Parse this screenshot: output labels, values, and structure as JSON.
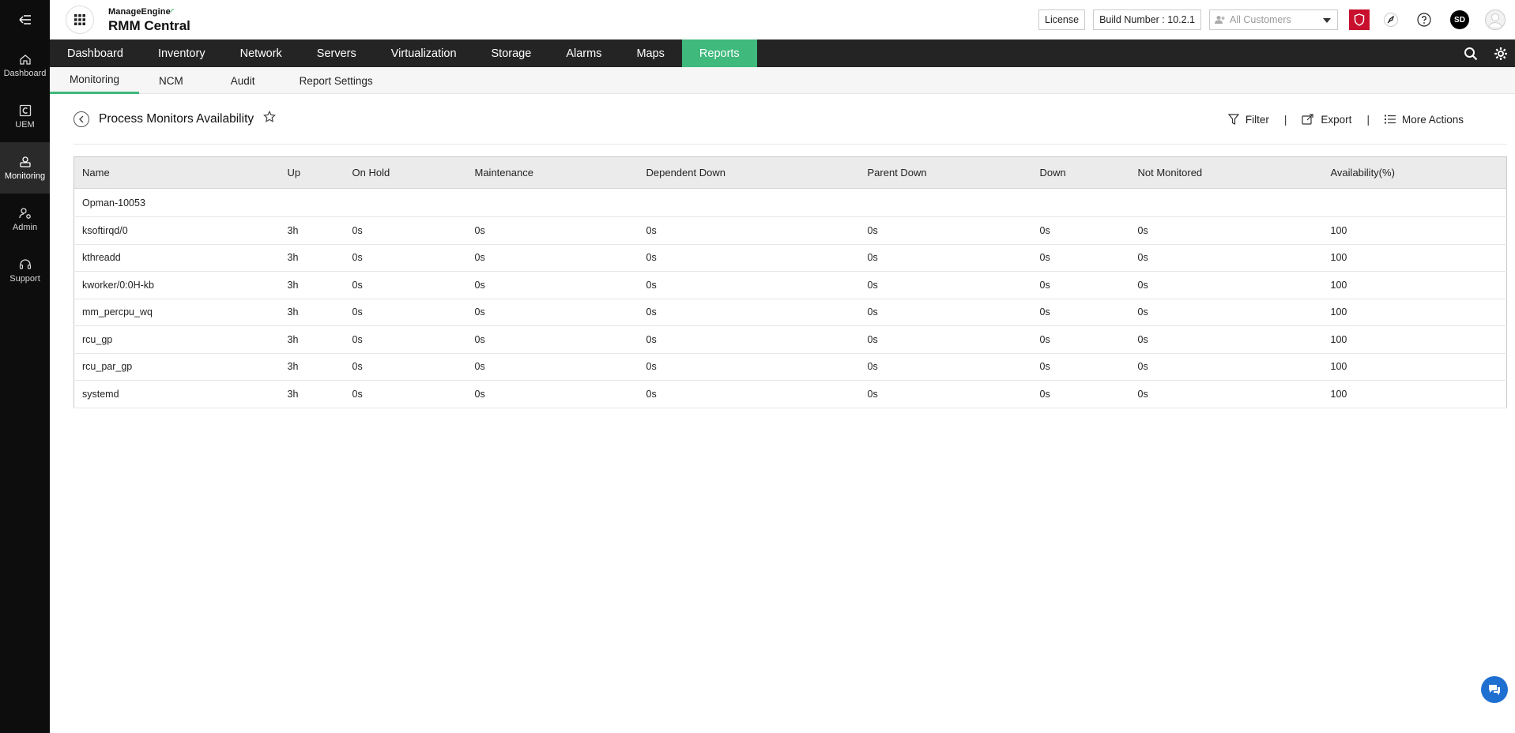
{
  "rail": {
    "items": [
      {
        "label": "Dashboard"
      },
      {
        "label": "UEM"
      },
      {
        "label": "Monitoring"
      },
      {
        "label": "Admin"
      },
      {
        "label": "Support"
      }
    ]
  },
  "header": {
    "brand_top": "ManageEngine",
    "brand_main": "RMM Central",
    "license_label": "License",
    "build_number": "Build Number : 10.2.1",
    "customer_placeholder": "All Customers",
    "avatar_initials": "SD"
  },
  "mainnav": {
    "items": [
      {
        "label": "Dashboard"
      },
      {
        "label": "Inventory"
      },
      {
        "label": "Network"
      },
      {
        "label": "Servers"
      },
      {
        "label": "Virtualization"
      },
      {
        "label": "Storage"
      },
      {
        "label": "Alarms"
      },
      {
        "label": "Maps"
      },
      {
        "label": "Reports"
      }
    ]
  },
  "subnav": {
    "items": [
      {
        "label": "Monitoring"
      },
      {
        "label": "NCM"
      },
      {
        "label": "Audit"
      },
      {
        "label": "Report Settings"
      }
    ]
  },
  "page": {
    "title": "Process Monitors Availability",
    "filter_label": "Filter",
    "export_label": "Export",
    "more_label": "More Actions",
    "separator": "|"
  },
  "table": {
    "headers": [
      "Name",
      "Up",
      "On Hold",
      "Maintenance",
      "Dependent Down",
      "Parent Down",
      "Down",
      "Not Monitored",
      "Availability(%)"
    ],
    "group": "Opman-10053",
    "rows": [
      [
        "ksoftirqd/0",
        "3h",
        "0s",
        "0s",
        "0s",
        "0s",
        "0s",
        "0s",
        "100"
      ],
      [
        "kthreadd",
        "3h",
        "0s",
        "0s",
        "0s",
        "0s",
        "0s",
        "0s",
        "100"
      ],
      [
        "kworker/0:0H-kb",
        "3h",
        "0s",
        "0s",
        "0s",
        "0s",
        "0s",
        "0s",
        "100"
      ],
      [
        "mm_percpu_wq",
        "3h",
        "0s",
        "0s",
        "0s",
        "0s",
        "0s",
        "0s",
        "100"
      ],
      [
        "rcu_gp",
        "3h",
        "0s",
        "0s",
        "0s",
        "0s",
        "0s",
        "0s",
        "100"
      ],
      [
        "rcu_par_gp",
        "3h",
        "0s",
        "0s",
        "0s",
        "0s",
        "0s",
        "0s",
        "100"
      ],
      [
        "systemd",
        "3h",
        "0s",
        "0s",
        "0s",
        "0s",
        "0s",
        "0s",
        "100"
      ]
    ]
  },
  "colors": {
    "accent": "#3fb97c",
    "nav_bg": "#242424",
    "rail_bg": "#0d0d0d",
    "alert": "#c8102e",
    "chat": "#1f6fd1"
  }
}
